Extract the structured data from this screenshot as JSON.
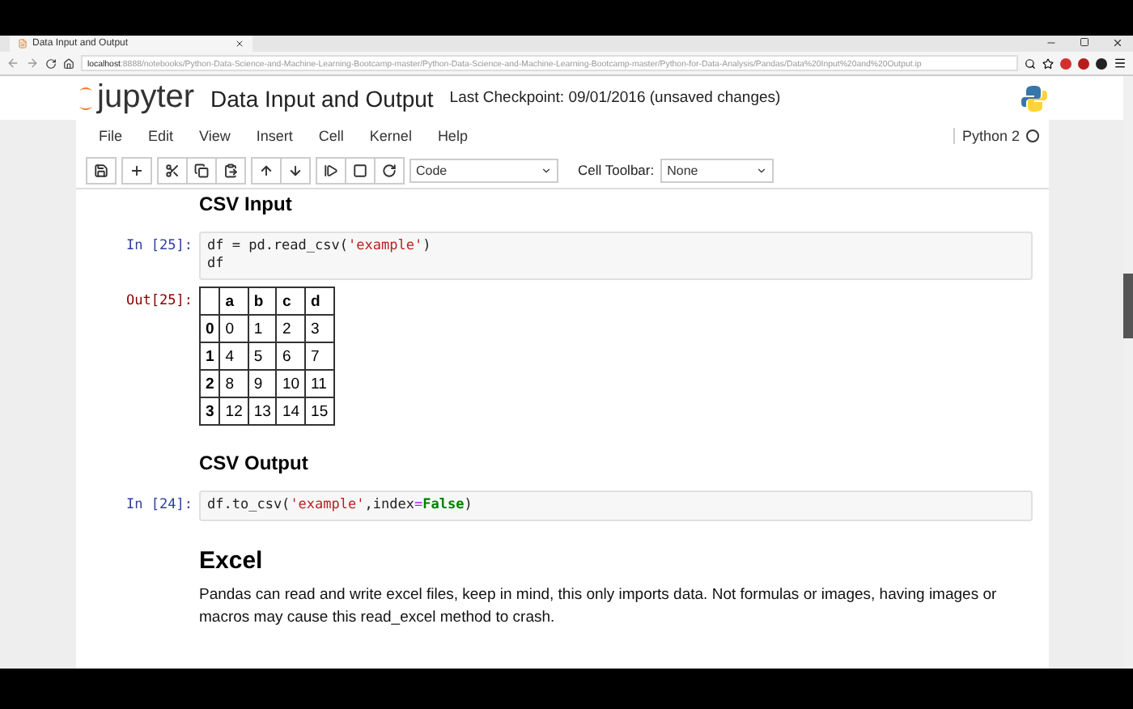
{
  "browser": {
    "tab_title": "Data Input and Output",
    "url_host": "localhost",
    "url_rest": ":8888/notebooks/Python-Data-Science-and-Machine-Learning-Bootcamp-master/Python-Data-Science-and-Machine-Learning-Bootcamp-master/Python-for-Data-Analysis/Pandas/Data%20Input%20and%20Output.ip"
  },
  "header": {
    "logo_text": "jupyter",
    "notebook_name": "Data Input and Output",
    "checkpoint": "Last Checkpoint: 09/01/2016 (unsaved changes)"
  },
  "menu": [
    "File",
    "Edit",
    "View",
    "Insert",
    "Cell",
    "Kernel",
    "Help"
  ],
  "kernel": {
    "name": "Python 2",
    "busy": false
  },
  "toolbar": {
    "cell_type": "Code",
    "cell_toolbar_label": "Cell Toolbar:",
    "cell_toolbar_value": "None"
  },
  "cells": [
    {
      "kind": "subheading",
      "text": "CSV Input"
    },
    {
      "kind": "code",
      "prompt": "In [25]:",
      "lines": [
        [
          {
            "t": "df = pd.read_csv(",
            "kind": "plain"
          },
          {
            "t": "'example'",
            "kind": "string"
          },
          {
            "t": ")",
            "kind": "plain"
          }
        ],
        [
          {
            "t": "df",
            "kind": "plain"
          }
        ]
      ]
    },
    {
      "kind": "table",
      "prompt": "Out[25]:",
      "columns": [
        "a",
        "b",
        "c",
        "d"
      ],
      "rows": [
        {
          "index": "0",
          "cells": [
            "0",
            "1",
            "2",
            "3"
          ]
        },
        {
          "index": "1",
          "cells": [
            "4",
            "5",
            "6",
            "7"
          ]
        },
        {
          "index": "2",
          "cells": [
            "8",
            "9",
            "10",
            "11"
          ]
        },
        {
          "index": "3",
          "cells": [
            "12",
            "13",
            "14",
            "15"
          ]
        }
      ]
    },
    {
      "kind": "subheading",
      "text": "CSV Output"
    },
    {
      "kind": "code",
      "prompt": "In [24]:",
      "lines": [
        [
          {
            "t": "df.to_csv(",
            "kind": "plain"
          },
          {
            "t": "'example'",
            "kind": "string"
          },
          {
            "t": ",index",
            "kind": "plain"
          },
          {
            "t": "=",
            "kind": "operator"
          },
          {
            "t": "False",
            "kind": "keyword"
          },
          {
            "t": ")",
            "kind": "plain"
          }
        ]
      ]
    },
    {
      "kind": "heading",
      "text": "Excel"
    },
    {
      "kind": "paragraph",
      "text": "Pandas can read and write excel files, keep in mind, this only imports data. Not formulas or images, having images or macros may cause this read_excel method to crash."
    }
  ]
}
